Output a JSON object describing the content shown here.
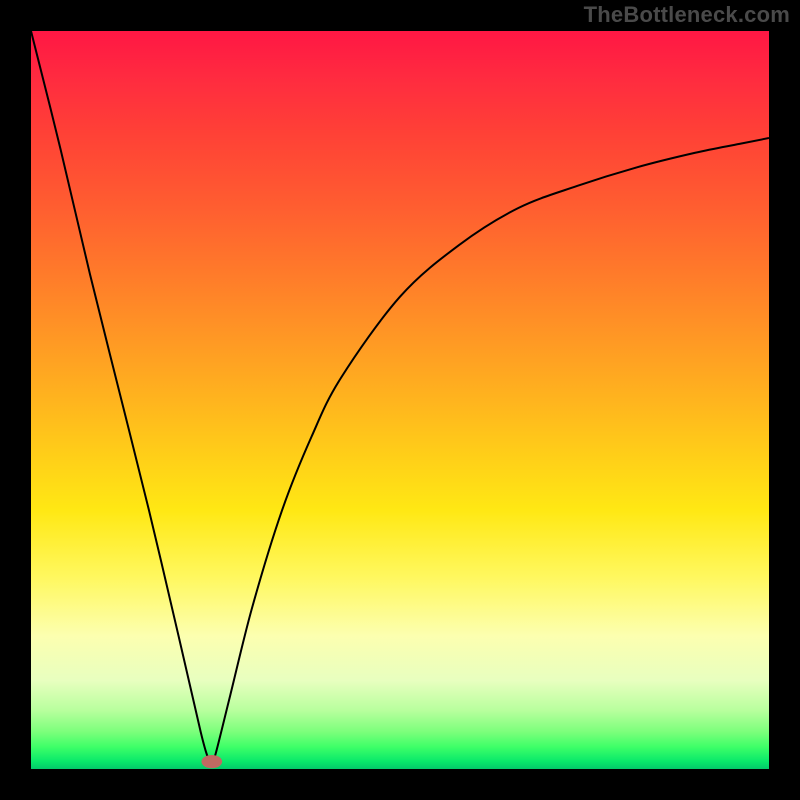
{
  "watermark": "TheBottleneck.com",
  "chart_data": {
    "type": "line",
    "title": "",
    "xlabel": "",
    "ylabel": "",
    "xlim": [
      0,
      100
    ],
    "ylim": [
      0,
      100
    ],
    "grid": false,
    "legend": false,
    "background": {
      "type": "vertical-gradient",
      "stops": [
        {
          "pos": 0,
          "color": "#ff1744"
        },
        {
          "pos": 24,
          "color": "#ff5e30"
        },
        {
          "pos": 50,
          "color": "#ffb41e"
        },
        {
          "pos": 74,
          "color": "#fff85f"
        },
        {
          "pos": 92,
          "color": "#b9ff9e"
        },
        {
          "pos": 100,
          "color": "#03c96a"
        }
      ]
    },
    "series": [
      {
        "name": "bottleneck-curve",
        "stroke": "#000000",
        "stroke_width": 2,
        "x": [
          0,
          4,
          8,
          12,
          16,
          20,
          23,
          24,
          24.5,
          25,
          27,
          30,
          34,
          38,
          42,
          50,
          58,
          66,
          74,
          82,
          90,
          96,
          100
        ],
        "y": [
          100,
          84,
          67,
          51,
          35,
          18,
          5,
          1.5,
          1,
          2,
          10,
          22,
          35,
          45,
          53,
          64,
          71,
          76,
          79,
          81.5,
          83.5,
          84.7,
          85.5
        ]
      }
    ],
    "markers": [
      {
        "name": "min-marker",
        "x": 24.5,
        "y": 1,
        "rx": 1.4,
        "ry": 0.9,
        "color": "#c06a62"
      }
    ]
  }
}
